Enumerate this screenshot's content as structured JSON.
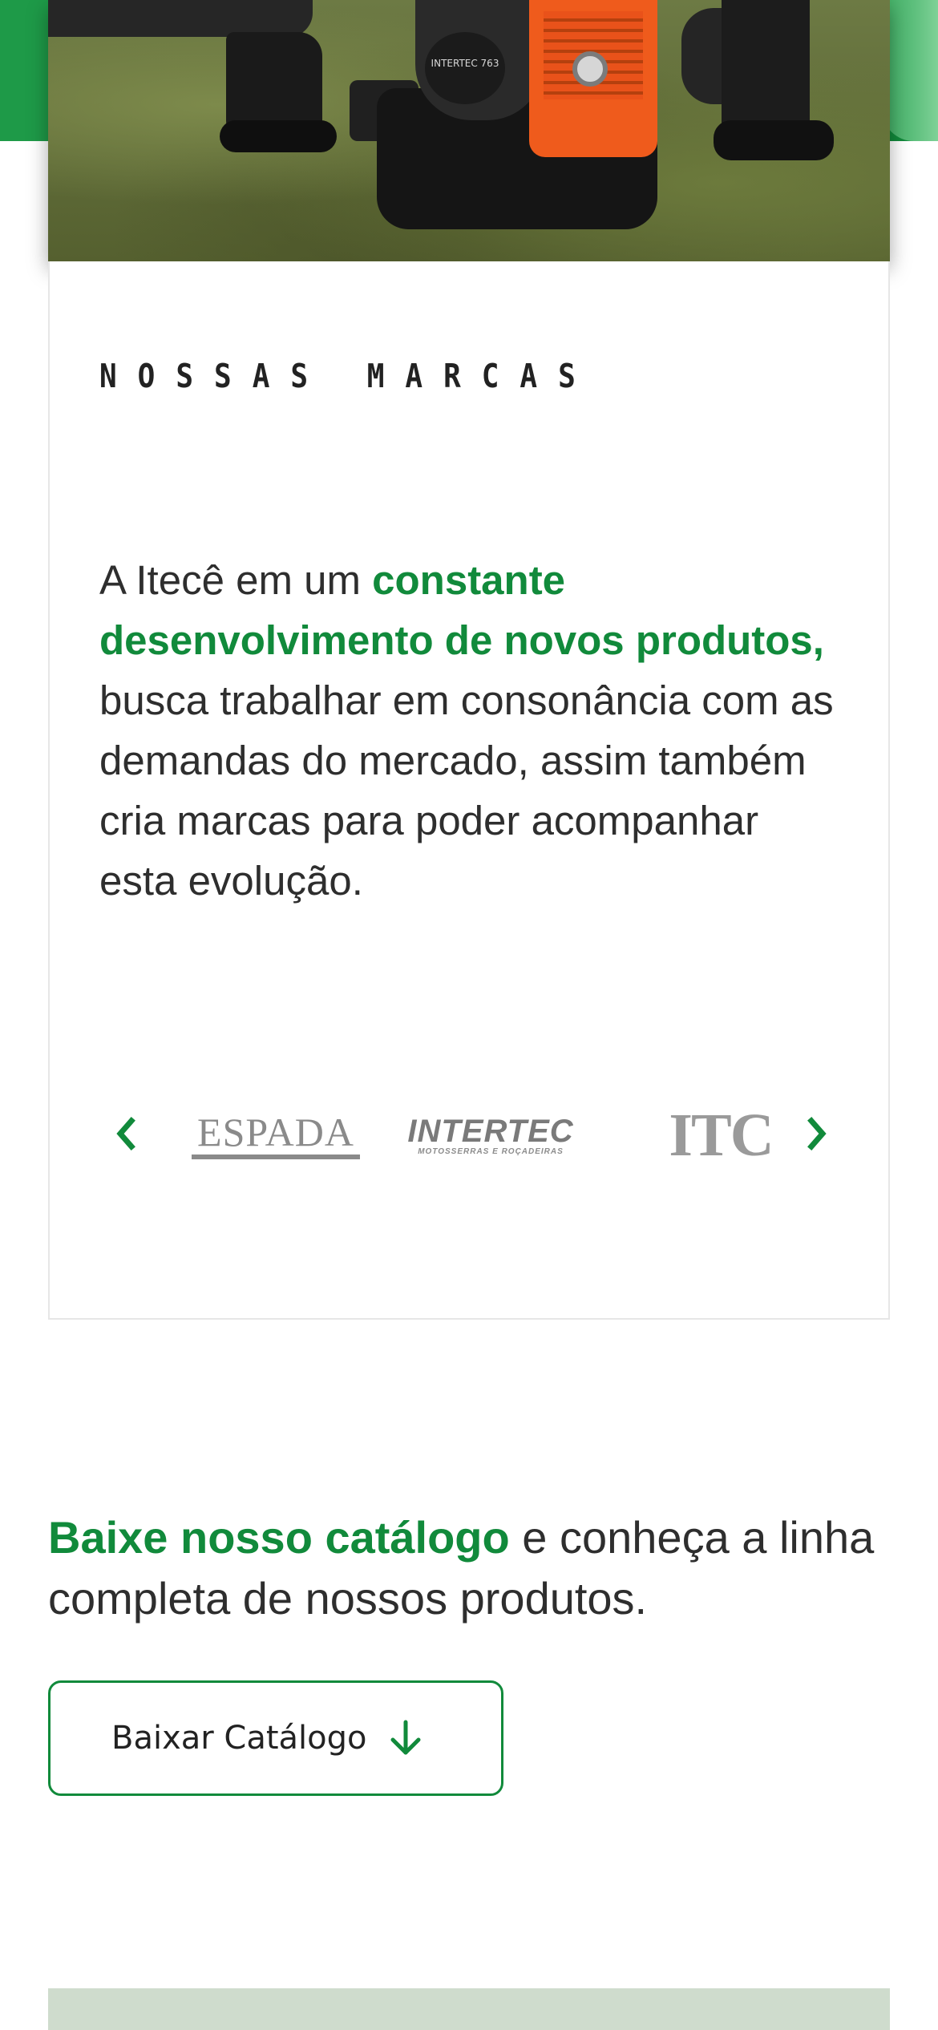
{
  "hero": {
    "image_alt": "Soprador costal INTERTEC em uso",
    "engine_label": "INTERTEC 763"
  },
  "brands": {
    "section_title": "NOSSAS MARCAS",
    "intro_prefix": "A Itecê em um ",
    "intro_highlight": "constante desenvolvimento de novos produtos,",
    "intro_suffix": " busca trabalhar em consonância com as demandas do mercado, assim também cria marcas para poder acompanhar esta evolução.",
    "carousel": {
      "prev_icon": "chevron-left-icon",
      "next_icon": "chevron-right-icon",
      "logos": [
        {
          "name": "ESPADA",
          "text": "ESPADA"
        },
        {
          "name": "INTERTEC",
          "text": "INTERTEC",
          "tagline": "MOTOSSERRAS E ROÇADEIRAS"
        },
        {
          "name": "ITC",
          "text": "ITC"
        }
      ]
    }
  },
  "catalog": {
    "highlight": "Baixe nosso catálogo",
    "text": " e conheça a linha completa de nossos produtos.",
    "button_label": "Baixar Catálogo",
    "button_icon": "arrow-down-icon"
  },
  "colors": {
    "brand_green": "#118a3b",
    "text": "#2e2e2e",
    "logo_gray": "#8a8a8a",
    "bottom_band": "#cfdccd"
  }
}
